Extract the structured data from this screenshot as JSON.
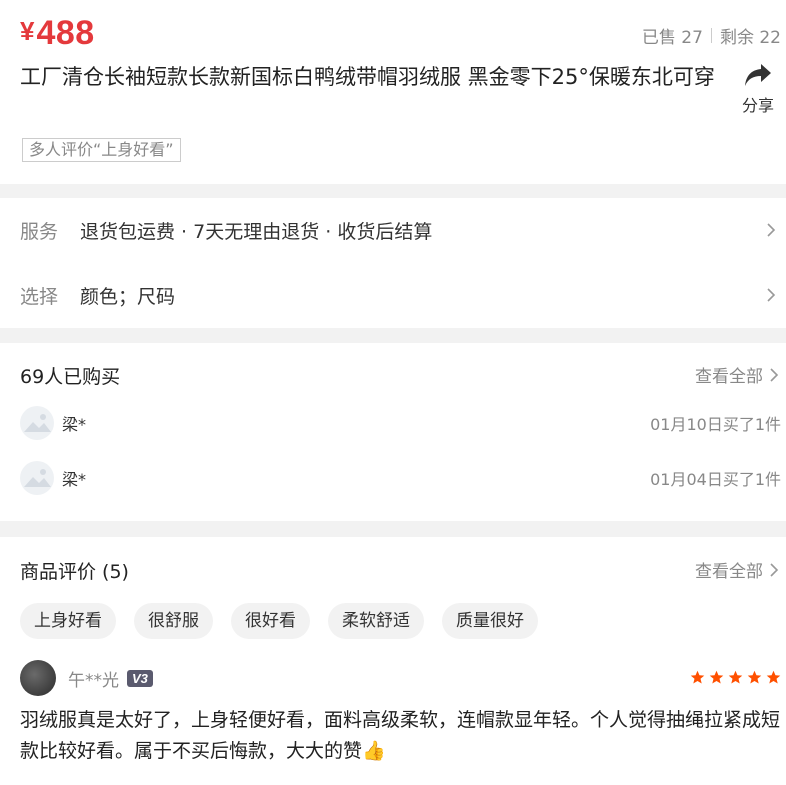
{
  "product": {
    "currency": "¥",
    "price": "488",
    "sold_label": "已售 27",
    "remaining_label": "剩余 22",
    "title": "工厂清仓长袖短款长款新国标白鸭绒带帽羽绒服 黑金零下25°保暖东北可穿",
    "share_label": "分享",
    "tag": "多人评价“上身好看”"
  },
  "service": {
    "label": "服务",
    "value": "退货包运费 · 7天无理由退货 · 收货后结算"
  },
  "select": {
    "label": "选择",
    "value": "颜色；尺码"
  },
  "buyers": {
    "title": "69人已购买",
    "see_all": "查看全部",
    "items": [
      {
        "name": "梁*",
        "info": "01月10日买了1件"
      },
      {
        "name": "梁*",
        "info": "01月04日买了1件"
      }
    ]
  },
  "reviews": {
    "title": "商品评价 (5)",
    "see_all": "查看全部",
    "chips": [
      "上身好看",
      "很舒服",
      "很好看",
      "柔软舒适",
      "质量很好"
    ],
    "items": [
      {
        "user": "午**光",
        "level": "V3",
        "rating": 5,
        "text": "羽绒服真是太好了，上身轻便好看，面料高级柔软，连帽款显年轻。个人觉得抽绳拉紧成短款比较好看。属于不买后悔款，大大的赞👍"
      }
    ]
  },
  "colors": {
    "price": "#e4393c",
    "star": "#ff5000",
    "badge": "#5a5a6e"
  }
}
